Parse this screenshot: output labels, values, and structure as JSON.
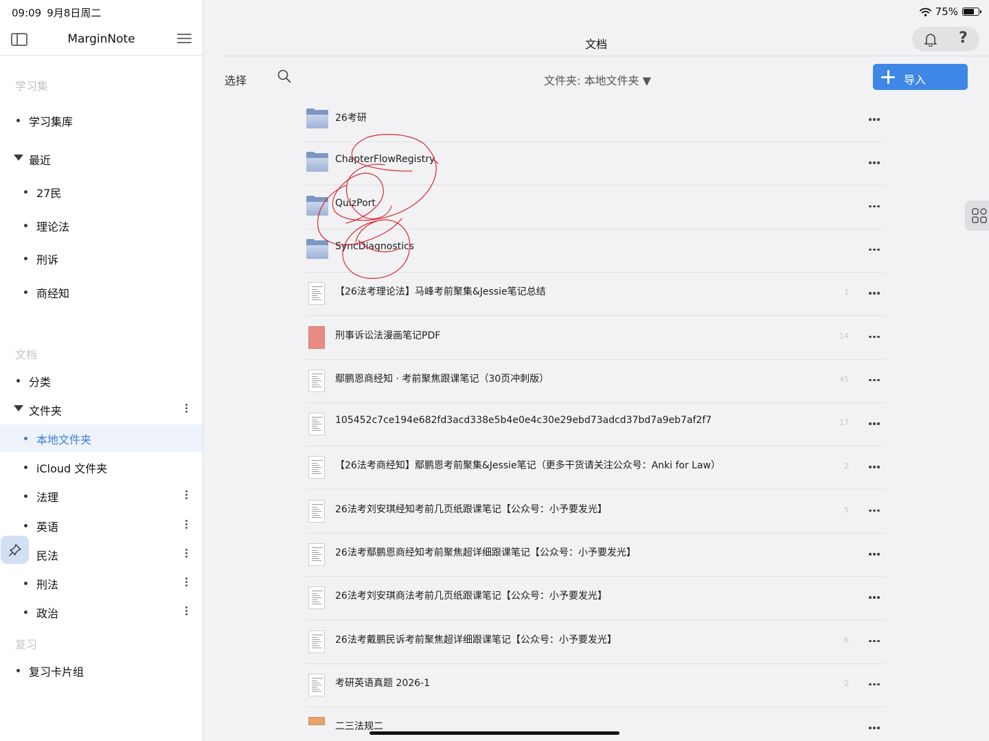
{
  "status_bar": {
    "time": "09:09",
    "date": "9月8日周二",
    "battery_text": "75%",
    "battery_level": 0.75
  },
  "sidebar": {
    "title": "MarginNote",
    "section_study": "学习集",
    "study_library": "学习集库",
    "recent": "最近",
    "recent_items": [
      "27民",
      "理论法",
      "刑诉",
      "商经知"
    ],
    "section_docs": "文档",
    "categories": "分类",
    "folders": "文件夹",
    "folder_items": [
      "本地文件夹",
      "iCloud 文件夹",
      "法理",
      "英语",
      "民法",
      "刑法",
      "政治"
    ],
    "section_review": "复习",
    "review_decks": "复习卡片组"
  },
  "main": {
    "title": "文档",
    "help_label": "?",
    "select_label": "选择",
    "folder_selector": "文件夹: 本地文件夹 ▼",
    "import_label": "导入",
    "rows": [
      {
        "name": "26考研",
        "type": "folder",
        "count": ""
      },
      {
        "name": "ChapterFlowRegistry",
        "type": "folder",
        "count": ""
      },
      {
        "name": "QuizPort",
        "type": "folder",
        "count": ""
      },
      {
        "name": "SyncDiagnostics",
        "type": "folder",
        "count": ""
      },
      {
        "name": "【26法考理论法】马峰考前聚集&Jessie笔记总结",
        "type": "pdf",
        "count": "1"
      },
      {
        "name": "刑事诉讼法漫画笔记PDF",
        "type": "pdf-cover",
        "count": "14"
      },
      {
        "name": "鄢鹏恩商经知 · 考前聚焦跟课笔记（30页冲刺版）",
        "type": "pdf",
        "count": "45"
      },
      {
        "name": "105452c7ce194e682fd3acd338e5b4e0e4c30e29ebd73adcd37bd7a9eb7af2f7",
        "type": "pdf",
        "count": "17"
      },
      {
        "name": "【26法考商经知】鄢鹏恩考前聚集&Jessie笔记（更多干货请关注公众号：Anki for Law）",
        "type": "pdf",
        "count": "2"
      },
      {
        "name": "26法考刘安琪经知考前几页纸跟课笔记【公众号：小予要发光】",
        "type": "pdf",
        "count": "5"
      },
      {
        "name": "26法考鄢鹏恩商经知考前聚焦超详细跟课笔记【公众号：小予要发光】",
        "type": "pdf",
        "count": ""
      },
      {
        "name": "26法考刘安琪商法考前几页纸跟课笔记【公众号：小予要发光】",
        "type": "pdf",
        "count": ""
      },
      {
        "name": "26法考戴鹏民诉考前聚焦超详细跟课笔记【公众号：小予要发光】",
        "type": "pdf",
        "count": "6"
      },
      {
        "name": "考研英语真题 2026-1",
        "type": "pdf",
        "count": "2"
      },
      {
        "name": "二三法规二",
        "type": "pdf-orange",
        "count": ""
      }
    ]
  },
  "colors": {
    "accent": "#3f87e6",
    "active_text": "#3d7dd8",
    "active_bg": "#eef3fb",
    "scribble": "#d8262c"
  }
}
